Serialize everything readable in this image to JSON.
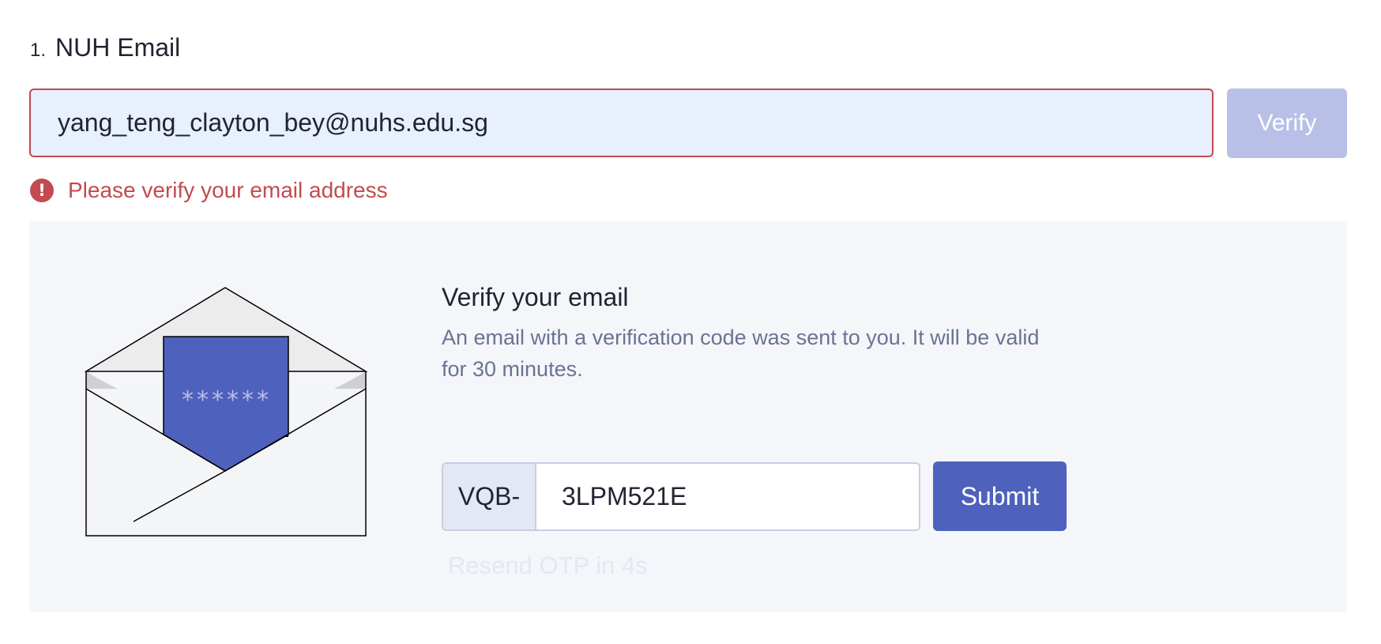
{
  "question": {
    "number": "1.",
    "title": "NUH Email"
  },
  "email_field": {
    "value": "yang_teng_clayton_bey@nuhs.edu.sg"
  },
  "verify_button": {
    "label": "Verify"
  },
  "error": {
    "icon": "!",
    "message": "Please verify your email address"
  },
  "otp_panel": {
    "envelope_code": "******",
    "title": "Verify your email",
    "description": "An email with a verification code was sent to you. It will be valid for 30 minutes.",
    "prefix": "VQB-",
    "code_value": "3LPM521E",
    "submit_label": "Submit",
    "resend_label": "Resend OTP in 4s"
  },
  "colors": {
    "error": "#c24b4f",
    "primary": "#4e61bd",
    "primary_disabled": "#b9c0e7",
    "input_bg": "#e8effd",
    "panel_bg": "#f4f6fa"
  }
}
